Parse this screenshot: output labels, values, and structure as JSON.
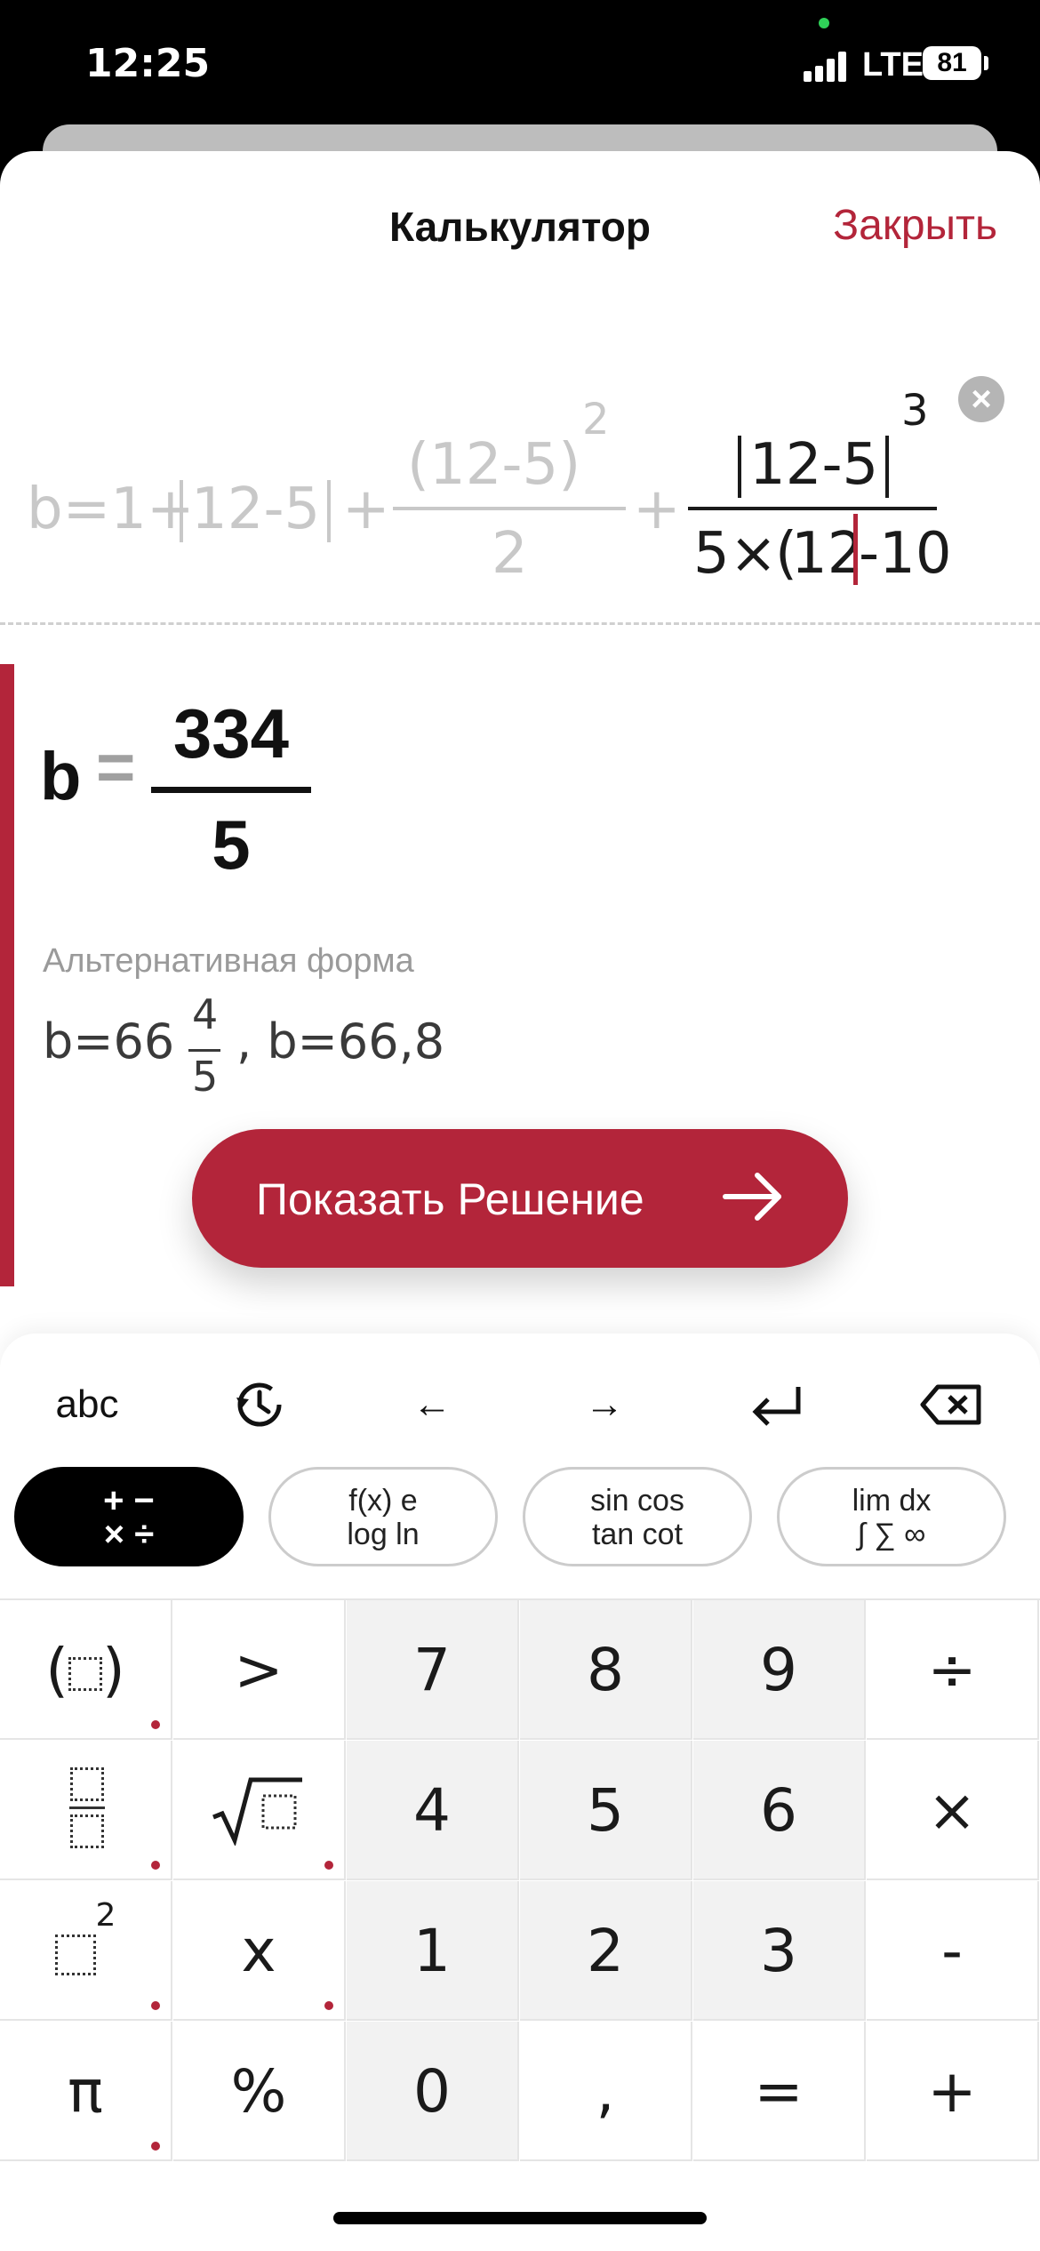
{
  "status_bar": {
    "time": "12:25",
    "network": "LTE",
    "battery": "81"
  },
  "header": {
    "title": "Калькулятор",
    "close_label": "Закрыть"
  },
  "expression": {
    "faded_prefix": "b=1+",
    "abs1": "12-5",
    "plus1": "+",
    "frac1_num": "(12-5)",
    "frac1_exp": "2",
    "frac1_den": "2",
    "plus2": "+",
    "frac2_num": "12-5",
    "frac2_exp": "3",
    "frac2_den_prefix": "5×",
    "frac2_den_paren": "(",
    "frac2_den_cursor_val": "12",
    "frac2_den_rest": "-10"
  },
  "result": {
    "variable": "b",
    "equals": "=",
    "numerator": "334",
    "denominator": "5",
    "alt_label": "Альтернативная форма",
    "alt_prefix": "b=66",
    "alt_frac_num": "4",
    "alt_frac_den": "5",
    "alt_suffix": ", b=66,8"
  },
  "solution_button": {
    "label": "Показать Решение"
  },
  "keyboard": {
    "top_row": [
      "abc",
      "history-icon",
      "←",
      "→",
      "enter-icon",
      "backspace-icon"
    ],
    "modes": [
      {
        "line1": "+ −",
        "line2": "× ÷"
      },
      {
        "line1": "f(x)  e",
        "line2": "log  ln"
      },
      {
        "line1": "sin cos",
        "line2": "tan cot"
      },
      {
        "line1": "lim   dx",
        "line2": "∫ ∑ ∞"
      }
    ],
    "keys": {
      "paren": "( )",
      "gt": ">",
      "k7": "7",
      "k8": "8",
      "k9": "9",
      "div": "÷",
      "frac": "",
      "sqrt": "√",
      "k4": "4",
      "k5": "5",
      "k6": "6",
      "mul": "×",
      "pow": "2",
      "x": "x",
      "k1": "1",
      "k2": "2",
      "k3": "3",
      "minus": "-",
      "pi": "π",
      "pct": "%",
      "k0": "0",
      "comma": ",",
      "eq": "=",
      "plus": "+"
    }
  },
  "colors": {
    "accent": "#b3253a"
  }
}
